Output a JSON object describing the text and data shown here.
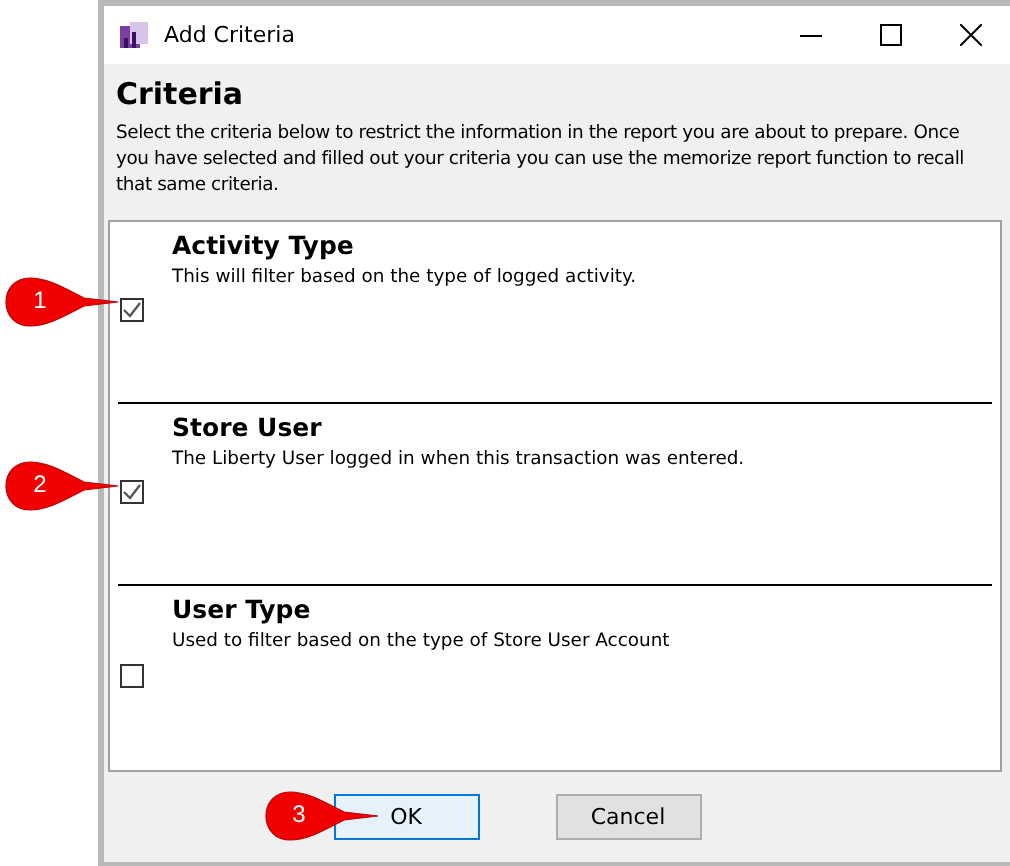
{
  "window": {
    "title": "Add Criteria"
  },
  "header": {
    "title": "Criteria",
    "description": "Select the criteria below to restrict the information in the report you are about to prepare. Once you have selected and filled out your criteria you can use the memorize report function to recall that same criteria."
  },
  "criteria": [
    {
      "title": "Activity Type",
      "description": "This will filter based on the type of logged activity.",
      "checked": true,
      "callout": "1"
    },
    {
      "title": "Store User",
      "description": "The Liberty User logged in when this transaction was entered.",
      "checked": true,
      "callout": "2"
    },
    {
      "title": "User Type",
      "description": "Used to filter based on the type of Store User Account",
      "checked": false
    }
  ],
  "buttons": [
    {
      "label": "OK",
      "default": true,
      "callout": "3"
    },
    {
      "label": "Cancel",
      "default": false
    }
  ]
}
